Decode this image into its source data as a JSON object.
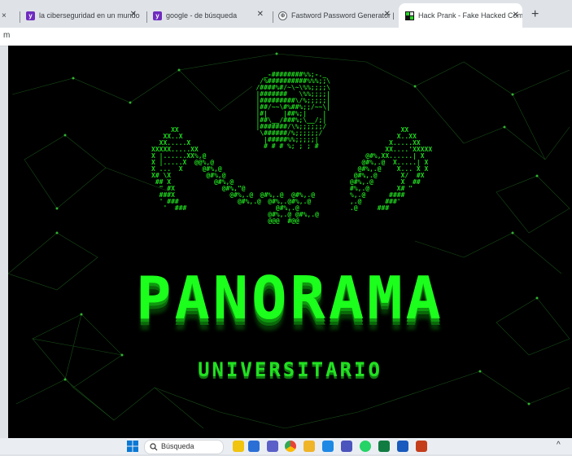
{
  "tabs": [
    {
      "label": "×",
      "color": "#3c4043"
    },
    {
      "label": "la ciberseguridad en un mundo c",
      "color": "#6f2bbf",
      "glyph": "y"
    },
    {
      "label": "google - de búsqueda",
      "color": "#6f2bbf",
      "glyph": "y"
    },
    {
      "label": "Fastword Password Generator | A",
      "color": "#5f6368",
      "glyph": "⊕"
    },
    {
      "label": "Hack Prank - Fake Hacked Comp",
      "color": "#1a1a1a",
      "glyph": "▦"
    }
  ],
  "address": {
    "text": "m"
  },
  "banner": {
    "title": "PANORAMA",
    "subtitle": "UNIVERSITARIO"
  },
  "taskbar": {
    "search_placeholder": "Búsqueda"
  }
}
